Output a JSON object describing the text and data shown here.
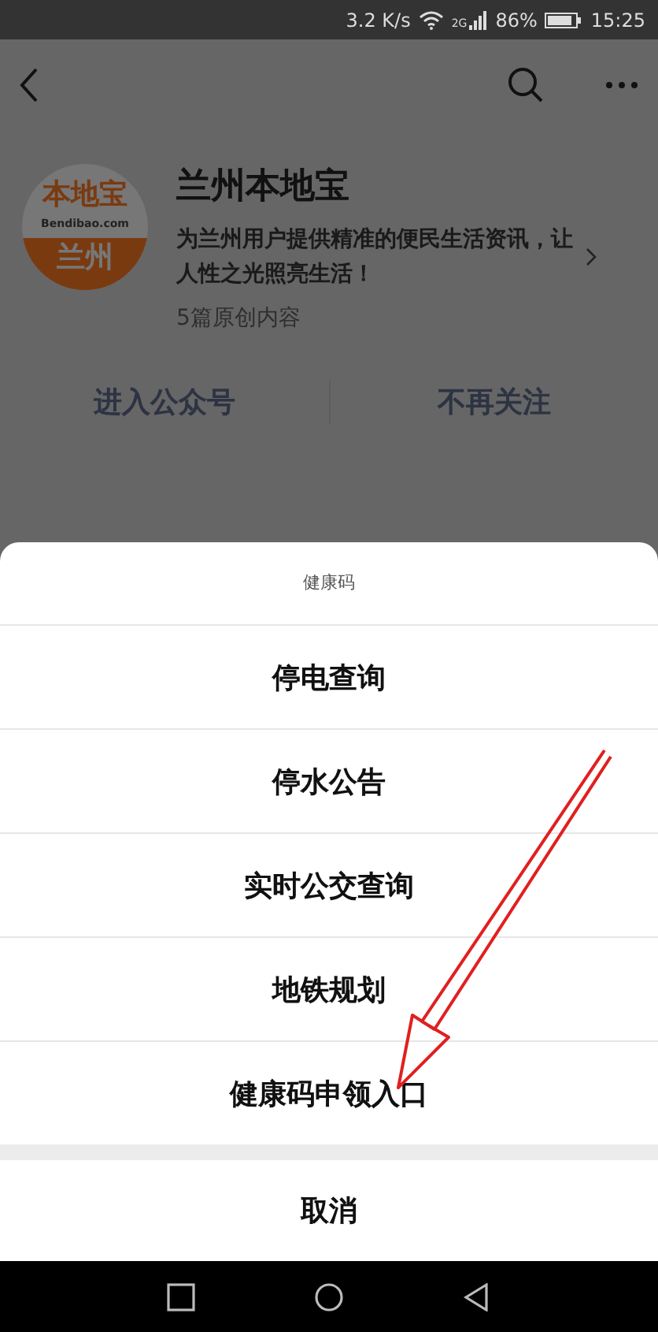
{
  "status_bar": {
    "speed": "3.2 K/s",
    "network": "2G",
    "battery": "86%",
    "time": "15:25"
  },
  "account": {
    "logo_top": "本地宝",
    "logo_site": "Bendibao.com",
    "logo_city": "兰州",
    "name": "兰州本地宝",
    "description": "为兰州用户提供精准的便民生活资讯，让人性之光照亮生活！",
    "count": "5篇原创内容",
    "buttons": [
      "进入公众号",
      "不再关注"
    ]
  },
  "action_sheet": {
    "title": "健康码",
    "items": [
      {
        "label": "停电查询"
      },
      {
        "label": "停水公告"
      },
      {
        "label": "实时公交查询"
      },
      {
        "label": "地铁规划"
      },
      {
        "label": "健康码申领入口"
      }
    ],
    "cancel": "取消"
  }
}
